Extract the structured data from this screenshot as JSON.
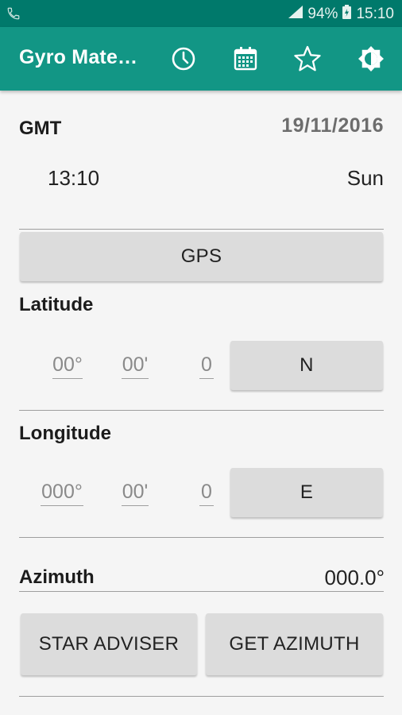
{
  "status_bar": {
    "battery": "94%",
    "time": "15:10",
    "icons": [
      "phone-icon",
      "signal-icon",
      "battery-icon"
    ]
  },
  "app_bar": {
    "title": "Gyro Mate…",
    "actions": [
      "clock-icon",
      "calendar-icon",
      "star-icon",
      "brightness-icon"
    ],
    "color": "#129685"
  },
  "gmt": {
    "label": "GMT",
    "date": "19/11/2016",
    "time": "13:10",
    "weekday": "Sun"
  },
  "gps_button": "GPS",
  "latitude": {
    "label": "Latitude",
    "degrees": "00°",
    "minutes": "00'",
    "tenths": "0",
    "hemisphere": "N"
  },
  "longitude": {
    "label": "Longitude",
    "degrees": "000°",
    "minutes": "00'",
    "tenths": "0",
    "hemisphere": "E"
  },
  "azimuth": {
    "label": "Azimuth",
    "value": "000.0°"
  },
  "buttons": {
    "star_adviser": "STAR ADVISER",
    "get_azimuth": "GET AZIMUTH"
  }
}
